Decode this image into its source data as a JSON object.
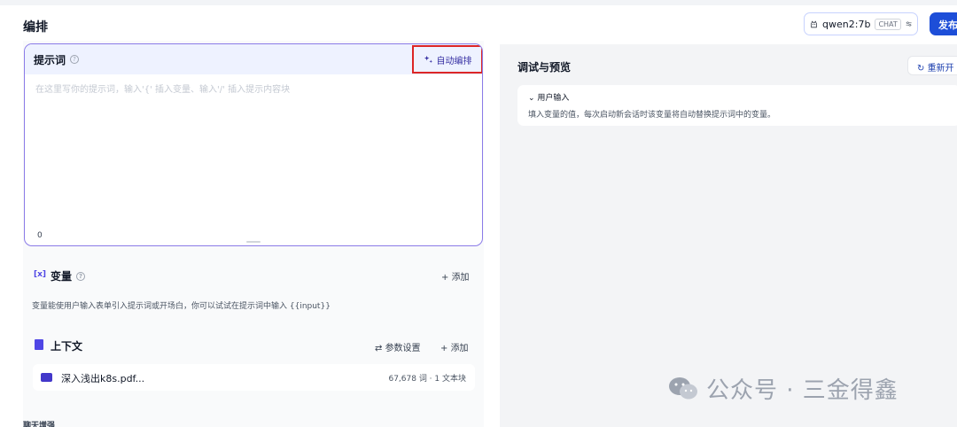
{
  "header": {
    "title": "编排",
    "model": {
      "name": "qwen2:7b",
      "badge": "CHAT"
    },
    "publish_label": "发布"
  },
  "prompt": {
    "label": "提示词",
    "auto_button": "自动编排",
    "placeholder": "在这里写你的提示词，输入'{' 插入变量、输入'/' 插入提示内容块",
    "char_count": "0"
  },
  "variables": {
    "title": "变量",
    "add_label": "添加",
    "description": "变量能使用户输入表单引入提示词或开场白，你可以试试在提示词中输入 {{input}}"
  },
  "context": {
    "title": "上下文",
    "param_label": "参数设置",
    "add_label": "添加",
    "file": {
      "name": "深入浅出k8s.pdf...",
      "meta": "67,678 词 · 1 文本块"
    }
  },
  "more_section_label": "聊天增强",
  "debug": {
    "title": "调试与预览",
    "restart_label": "重新开",
    "user_input_label": "用户输入",
    "user_input_desc": "填入变量的值，每次启动新会话时该变量将自动替换提示词中的变量。"
  },
  "watermark": "公众号 · 三金得鑫",
  "colors": {
    "accent": "#1d4ed8",
    "highlight": "#dc2626",
    "prompt_border": "#8b7be8"
  }
}
